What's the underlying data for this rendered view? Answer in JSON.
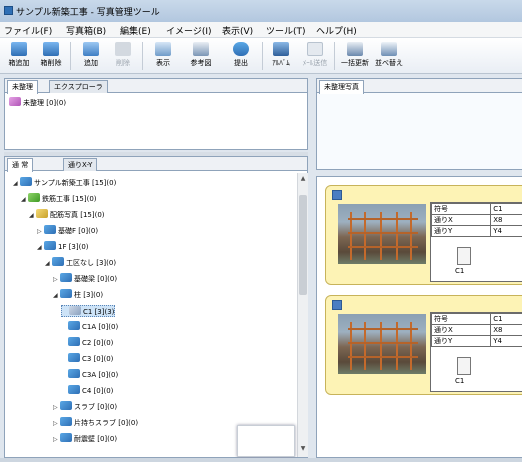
{
  "app": {
    "title": "サンプル新築工事 - 写真管理ツール"
  },
  "menu": [
    "ファイル(F)",
    "写真箱(B)",
    "編集(E)",
    "イメージ(I)",
    "表示(V)",
    "ツール(T)",
    "ヘルプ(H)"
  ],
  "toolbar": [
    {
      "label": "箱追加",
      "icon": "add-box-icon",
      "enabled": true
    },
    {
      "label": "箱削除",
      "icon": "delete-box-icon",
      "enabled": true
    },
    {
      "label": "追加",
      "icon": "add-photo-icon",
      "enabled": true
    },
    {
      "label": "削除",
      "icon": "delete-photo-icon",
      "enabled": false
    },
    {
      "label": "表示",
      "icon": "view-icon",
      "enabled": true
    },
    {
      "label": "参考図",
      "icon": "reference-drawing-icon",
      "enabled": true
    },
    {
      "label": "提出",
      "icon": "submit-icon",
      "enabled": true
    },
    {
      "label": "ｱﾙﾊﾞﾑ",
      "icon": "album-icon",
      "enabled": true
    },
    {
      "label": "ﾒｰﾙ送信",
      "icon": "mail-icon",
      "enabled": false
    },
    {
      "label": "一括更新",
      "icon": "bulk-update-icon",
      "enabled": true
    },
    {
      "label": "並べ替え",
      "icon": "sort-icon",
      "enabled": true
    }
  ],
  "top_left_panel": {
    "tabs": [
      "未整理",
      "エクスプローラ"
    ],
    "active_tab": 0,
    "item": "未整理 [0](0)"
  },
  "unsorted_photos_tab": "未整理写真",
  "tree_panel": {
    "tabs": [
      "通 常",
      "通りX-Y"
    ],
    "active_tab": 0,
    "nodes": [
      {
        "label": "サンプル新築工事 [15](0)",
        "icon": "blue",
        "twisty": "◢",
        "indent": 0
      },
      {
        "label": "鉄筋工事 [15](0)",
        "icon": "green",
        "twisty": "◢",
        "indent": 1
      },
      {
        "label": "配筋写真 [15](0)",
        "icon": "yellow",
        "twisty": "◢",
        "indent": 2
      },
      {
        "label": "基礎F [0](0)",
        "icon": "blue",
        "twisty": "▷",
        "indent": 3
      },
      {
        "label": "1F [3](0)",
        "icon": "blue",
        "twisty": "◢",
        "indent": 3
      },
      {
        "label": "工区なし [3](0)",
        "icon": "blue",
        "twisty": "◢",
        "indent": 4
      },
      {
        "label": "基礎梁 [0](0)",
        "icon": "blue",
        "twisty": "▷",
        "indent": 5
      },
      {
        "label": "柱 [3](0)",
        "icon": "blue",
        "twisty": "◢",
        "indent": 5
      },
      {
        "label": "C1 [3](3)",
        "icon": "grey",
        "twisty": "",
        "indent": 6,
        "selected": true
      },
      {
        "label": "C1A [0](0)",
        "icon": "blue",
        "twisty": "",
        "indent": 6
      },
      {
        "label": "C2 [0](0)",
        "icon": "blue",
        "twisty": "",
        "indent": 6
      },
      {
        "label": "C3 [0](0)",
        "icon": "blue",
        "twisty": "",
        "indent": 6
      },
      {
        "label": "C3A [0](0)",
        "icon": "blue",
        "twisty": "",
        "indent": 6
      },
      {
        "label": "C4 [0](0)",
        "icon": "blue",
        "twisty": "",
        "indent": 6
      },
      {
        "label": "スラブ [0](0)",
        "icon": "blue",
        "twisty": "▷",
        "indent": 5
      },
      {
        "label": "片持ちスラブ [0](0)",
        "icon": "blue",
        "twisty": "▷",
        "indent": 5
      },
      {
        "label": "耐震壁 [0](0)",
        "icon": "blue",
        "twisty": "▷",
        "indent": 5
      }
    ]
  },
  "photo_cards": [
    {
      "rows": [
        [
          "符号",
          "C1"
        ],
        [
          "通りX",
          "X8"
        ],
        [
          "通りY",
          "Y4"
        ]
      ],
      "sketch_caption": "C1"
    },
    {
      "rows": [
        [
          "符号",
          "C1"
        ],
        [
          "通りX",
          "X8"
        ],
        [
          "通りY",
          "Y4"
        ]
      ],
      "sketch_caption": "C1"
    }
  ],
  "colors": {
    "card_bg": "#fdf3b5",
    "accent": "#2f6fb5",
    "panel_border": "#8fa3ba"
  }
}
